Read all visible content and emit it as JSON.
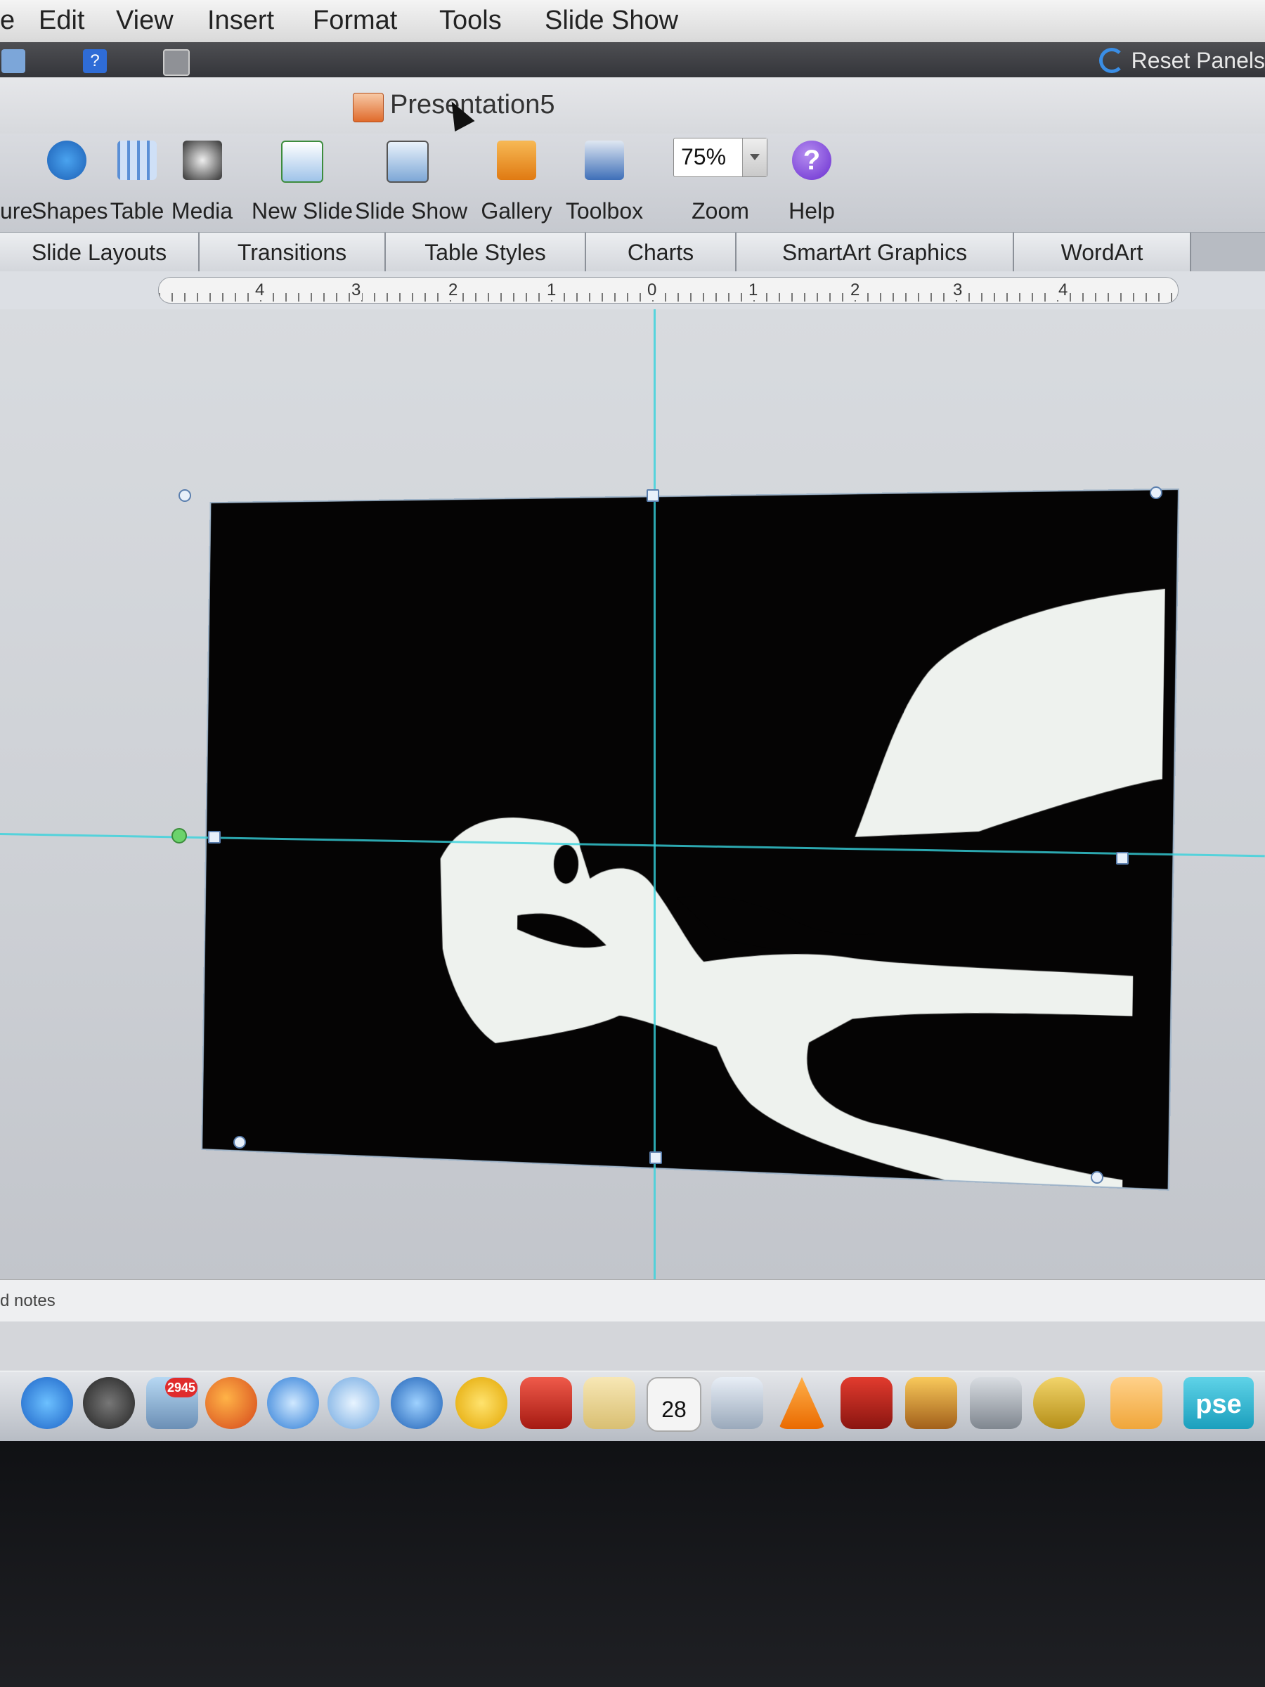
{
  "menu": [
    "e",
    "Edit",
    "View",
    "Insert",
    "Format",
    "Tools",
    "Slide Show"
  ],
  "reset_panels": "Reset Panels",
  "document": {
    "title": "Presentation5"
  },
  "ribbon": {
    "buttons": [
      "ure",
      "Shapes",
      "Table",
      "Media",
      "New Slide",
      "Slide Show",
      "Gallery",
      "Toolbox",
      "Zoom",
      "Help"
    ],
    "zoom_value": "75%",
    "help_glyph": "?"
  },
  "tabs": [
    "Slide Layouts",
    "Transitions",
    "Table Styles",
    "Charts",
    "SmartArt Graphics",
    "WordArt"
  ],
  "ruler": {
    "labels": [
      "4",
      "3",
      "2",
      "1",
      "0",
      "1",
      "2",
      "3",
      "4"
    ]
  },
  "notes": {
    "label": "d notes"
  },
  "dock": {
    "mail_badge": "2945",
    "calendar_day": "28",
    "pse_label": "pse",
    "icons": [
      "app-store-icon",
      "dashboard-icon",
      "mail-icon",
      "firefox-icon",
      "safari-icon",
      "messages-icon",
      "itunes-icon",
      "yahoo-messenger-icon",
      "chair-icon",
      "notes-icon",
      "calendar-icon",
      "preview-icon",
      "vlc-icon",
      "photobooth-icon",
      "iphoto-icon",
      "image-capture-icon",
      "keychain-icon",
      "stickies-icon",
      "pse-icon"
    ]
  },
  "colors": {
    "guide": "#36d2dc",
    "accent": "#3a8ee6",
    "help": "#6a2ed0"
  }
}
